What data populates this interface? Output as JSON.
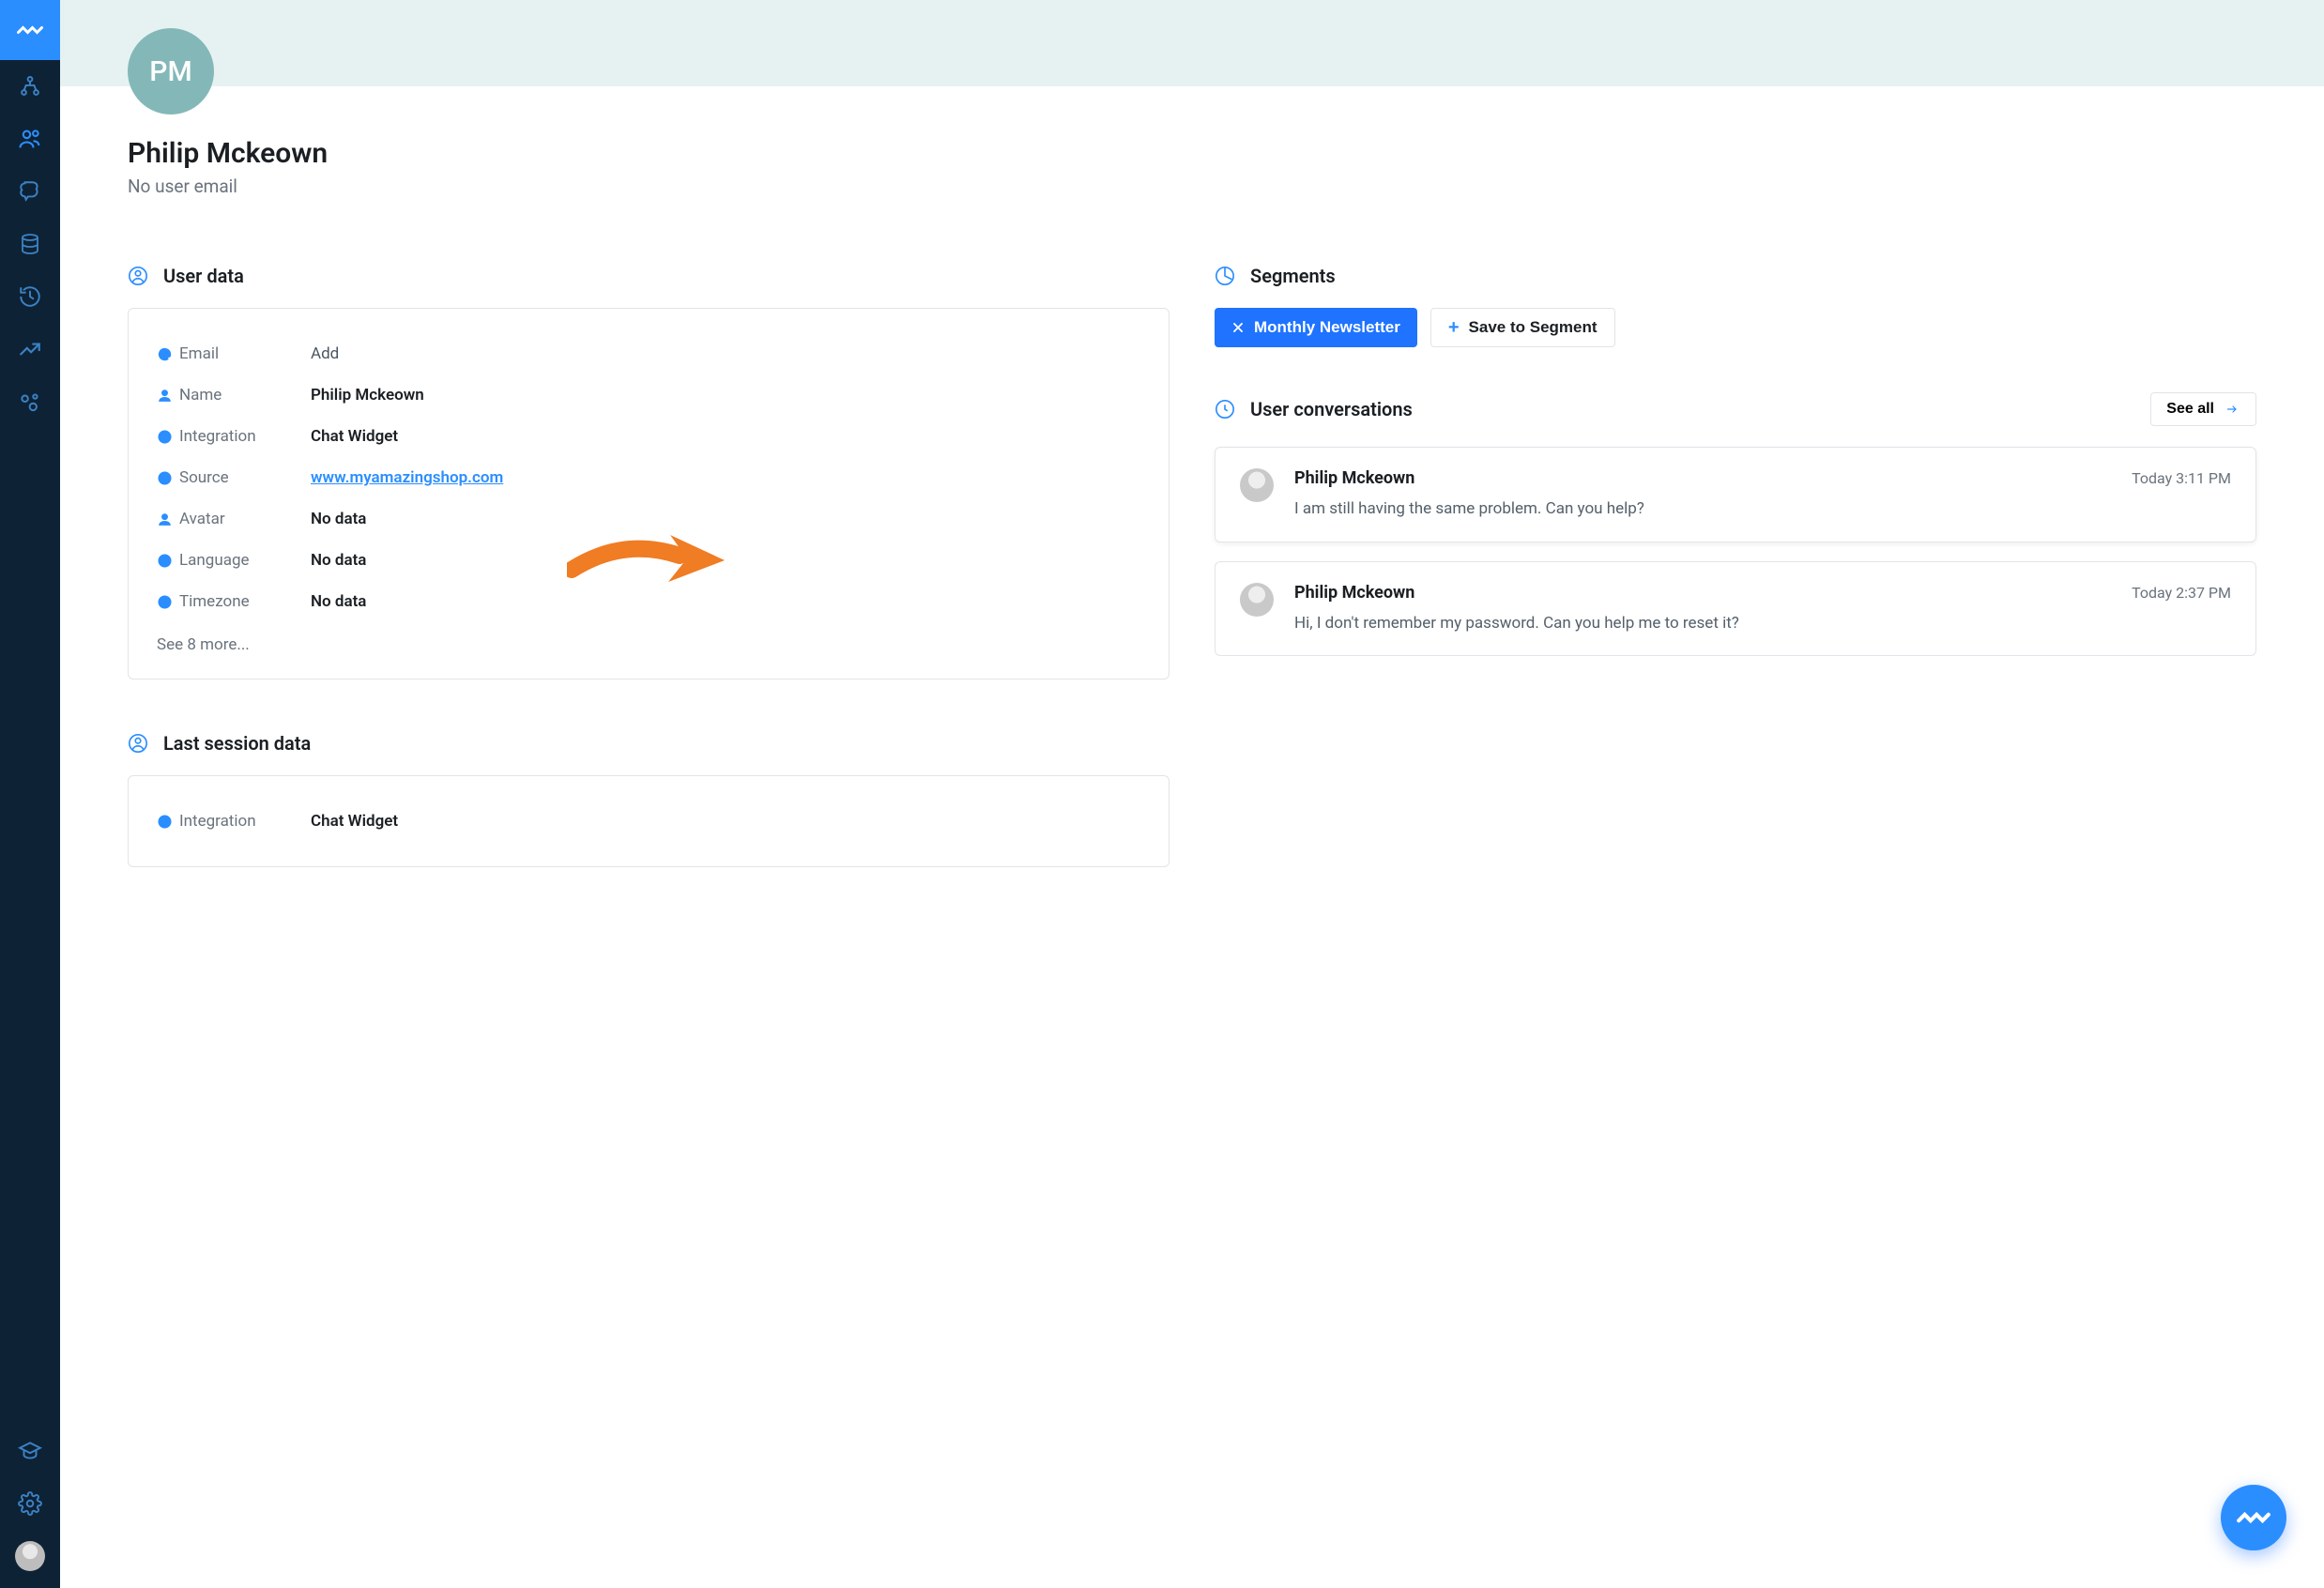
{
  "profile": {
    "initials": "PM",
    "name": "Philip Mckeown",
    "subtitle": "No user email"
  },
  "sections": {
    "user_data": "User data",
    "segments": "Segments",
    "conversations": "User conversations",
    "last_session": "Last session data"
  },
  "user_data": {
    "rows": [
      {
        "icon": "at",
        "label": "Email",
        "value": "Add",
        "style": "muted"
      },
      {
        "icon": "user",
        "label": "Name",
        "value": "Philip Mckeown",
        "style": "bold"
      },
      {
        "icon": "globe",
        "label": "Integration",
        "value": "Chat Widget",
        "style": "bold"
      },
      {
        "icon": "globe",
        "label": "Source",
        "value": "www.myamazingshop.com",
        "style": "link"
      },
      {
        "icon": "user-o",
        "label": "Avatar",
        "value": "No data",
        "style": "bold"
      },
      {
        "icon": "globe",
        "label": "Language",
        "value": "No data",
        "style": "bold"
      },
      {
        "icon": "globe",
        "label": "Timezone",
        "value": "No data",
        "style": "bold"
      }
    ],
    "see_more": "See 8 more..."
  },
  "last_session": {
    "rows": [
      {
        "icon": "globe",
        "label": "Integration",
        "value": "Chat Widget",
        "style": "bold"
      }
    ]
  },
  "segments": {
    "chip_label": "Monthly Newsletter",
    "save_label": "Save to Segment"
  },
  "conversations": {
    "see_all": "See all",
    "items": [
      {
        "name": "Philip Mckeown",
        "time": "Today 3:11 PM",
        "message": "I am still having the same problem. Can you help?"
      },
      {
        "name": "Philip Mckeown",
        "time": "Today 2:37 PM",
        "message": "Hi, I don't remember my password. Can you help me to reset it?"
      }
    ]
  },
  "colors": {
    "accent": "#2b8eff",
    "sidebar": "#0e2235",
    "banner": "#e6f2f2",
    "avatar": "#84b8b8",
    "annotation": "#f07c23"
  }
}
